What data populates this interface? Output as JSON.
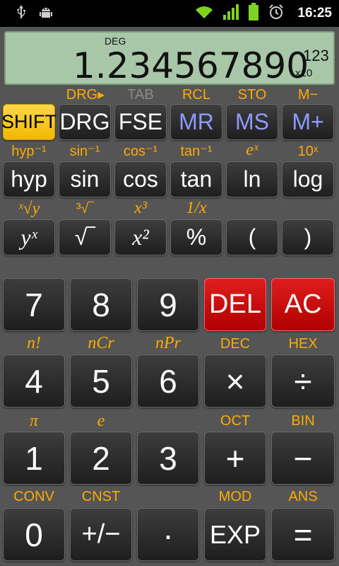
{
  "status_bar": {
    "time": "16:25",
    "icons": [
      "usb-icon",
      "android-debug-icon",
      "wifi-icon",
      "signal-icon",
      "battery-icon",
      "alarm-icon"
    ]
  },
  "display": {
    "mode": "DEG",
    "value": "1.234567890",
    "exponent": "123",
    "exp_base": "x10"
  },
  "rows": {
    "row1_shift": [
      "DRG▸",
      "TAB",
      "RCL",
      "STO",
      "M−"
    ],
    "row1_keys": [
      "SHIFT",
      "DRG",
      "FSE",
      "MR",
      "MS",
      "M+"
    ],
    "row2_shift": [
      "hyp⁻¹",
      "sin⁻¹",
      "cos⁻¹",
      "tan⁻¹",
      "eˣ",
      "10ˣ"
    ],
    "row2_keys": [
      "hyp",
      "sin",
      "cos",
      "tan",
      "ln",
      "log"
    ],
    "row3_shift": [
      "ˣ√y",
      "³√‾",
      "x³",
      "1/x"
    ],
    "row3_keys": [
      "yˣ",
      "√‾",
      "x²",
      "%",
      "(",
      ")"
    ],
    "num1_keys": [
      "7",
      "8",
      "9",
      "DEL",
      "AC"
    ],
    "num2_shift": [
      "n!",
      "nCr",
      "nPr",
      "DEC",
      "HEX"
    ],
    "num2_keys": [
      "4",
      "5",
      "6",
      "×",
      "÷"
    ],
    "num3_shift": [
      "π",
      "e",
      "OCT",
      "BIN"
    ],
    "num3_keys": [
      "1",
      "2",
      "3",
      "+",
      "−"
    ],
    "num4_shift": [
      "CONV",
      "CNST",
      "MOD",
      "ANS"
    ],
    "num4_keys": [
      "0",
      "+/−",
      "·",
      "EXP",
      "="
    ]
  },
  "colors": {
    "background": "#555555",
    "shift_label": "#ffaa00",
    "memory_key_text": "#8d9bff",
    "shift_key": "#f2b800",
    "red_key": "#cc0000",
    "display": "#a8c7a8"
  }
}
